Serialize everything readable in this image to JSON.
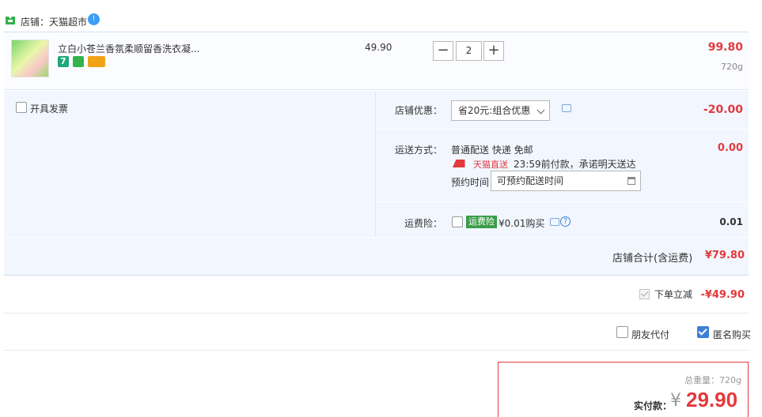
{
  "shop": {
    "label": "店铺：天猫超市",
    "chat_badge": "!"
  },
  "product": {
    "title": "立白小苍兰香氛柔顺留香洗衣凝...",
    "tag7": "7",
    "unit_price": "49.90",
    "quantity": "2",
    "line_total": "99.80",
    "weight": "720g"
  },
  "invoice": {
    "label": "开具发票"
  },
  "discount": {
    "label": "店铺优惠：",
    "selected": "省20元:组合优惠",
    "amount": "-20.00"
  },
  "shipping": {
    "label": "运送方式：",
    "method": "普通配送 快递 免邮",
    "amount": "0.00",
    "badge": "天猫直送",
    "promise": "23:59前付款，承诺明天送达",
    "appoint_label": "预约时间",
    "appoint_placeholder": "可预约配送时间"
  },
  "insurance": {
    "label": "运费险：",
    "tag": "运费险",
    "price": "¥0.01购买",
    "help": "?",
    "amount": "0.01"
  },
  "shop_total": {
    "label": "店铺合计(含运费)",
    "amount": "¥79.80"
  },
  "instant_discount": {
    "label": "下单立减",
    "amount": "-¥49.90"
  },
  "pay_options": {
    "friend_pay": "朋友代付",
    "anonymous": "匿名购买"
  },
  "summary": {
    "total_weight": "总重量：720g",
    "pay_label": "实付款：",
    "currency": "¥",
    "amount": "29.90"
  },
  "colors": {
    "accent_red": "#e4393c",
    "panel_bg": "#f2f7ff",
    "primary_blue": "#3d7fd6"
  }
}
